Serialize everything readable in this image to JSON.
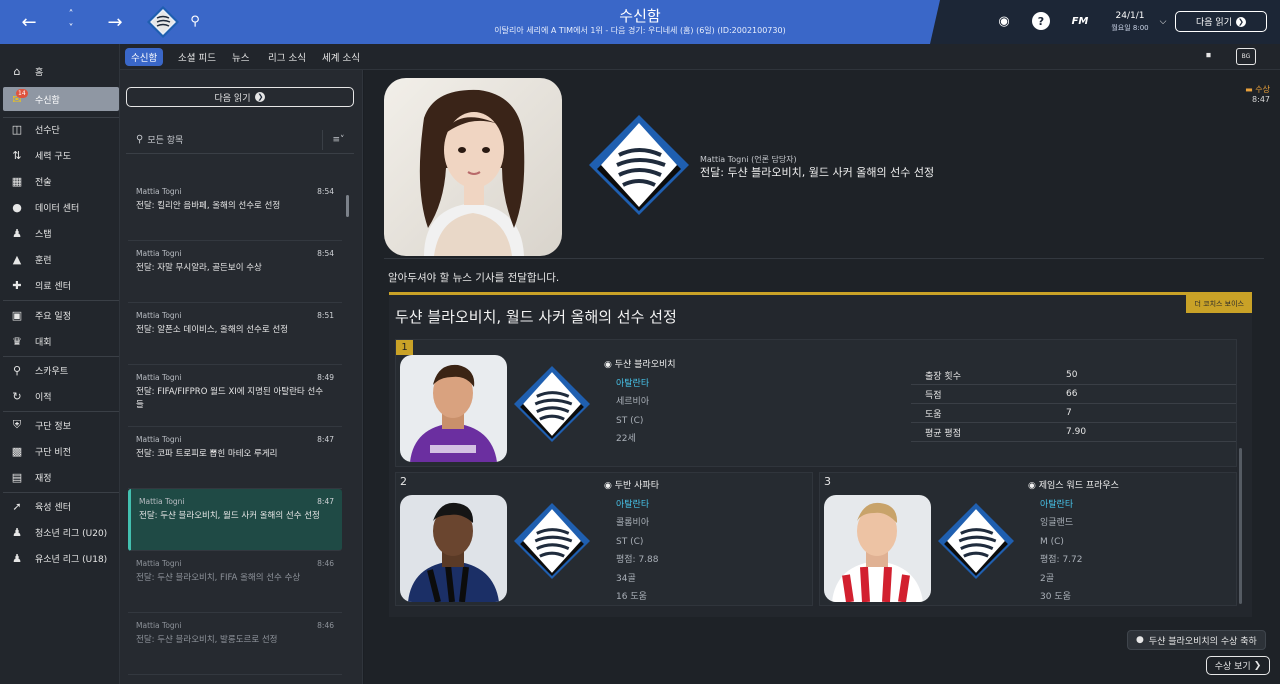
{
  "topbar": {
    "title": "수신함",
    "subtitle": "이탈리아 세리에 A TIM에서 1위 - 다음 경기: 우디네세 (홈) (6일) (ID:2002100730)",
    "date": "24/1/1",
    "day": "월요일 8:00",
    "next_label": "다음 읽기",
    "fm_label": "FM"
  },
  "sidebar": {
    "items": [
      {
        "label": "홈",
        "icon": "home-icon"
      },
      {
        "label": "수신함",
        "icon": "inbox-icon",
        "badge": "14"
      },
      {
        "label": "선수단",
        "icon": "shirt-icon"
      },
      {
        "label": "세력 구도",
        "icon": "dynamics-icon"
      },
      {
        "label": "전술",
        "icon": "tactics-icon"
      },
      {
        "label": "데이터 센터",
        "icon": "data-icon"
      },
      {
        "label": "스탭",
        "icon": "staff-icon"
      },
      {
        "label": "훈련",
        "icon": "training-icon"
      },
      {
        "label": "의료 센터",
        "icon": "medical-icon"
      },
      {
        "label": "주요 일정",
        "icon": "calendar-icon"
      },
      {
        "label": "대회",
        "icon": "trophy-icon"
      },
      {
        "label": "스카우트",
        "icon": "scout-icon"
      },
      {
        "label": "이적",
        "icon": "transfer-icon"
      },
      {
        "label": "구단 정보",
        "icon": "shield-icon"
      },
      {
        "label": "구단 비전",
        "icon": "vision-icon"
      },
      {
        "label": "재정",
        "icon": "finance-icon"
      },
      {
        "label": "육성 센터",
        "icon": "development-icon"
      },
      {
        "label": "청소년 리그 (U20)",
        "icon": "youth-icon"
      },
      {
        "label": "유소년 리그 (U18)",
        "icon": "youth-icon"
      }
    ]
  },
  "subtabs": [
    "수신함",
    "소셜 피드",
    "뉴스",
    "리그 소식",
    "세계 소식"
  ],
  "list": {
    "next_label": "다음 읽기",
    "search_placeholder": "모든 항목",
    "messages": [
      {
        "from": "Mattia Togni",
        "time": "8:54",
        "subject": "전달: 킬리안 음바페, 올해의 선수로 선정"
      },
      {
        "from": "Mattia Togni",
        "time": "8:54",
        "subject": "전달: 자말 무시알라, 골든보이 수상"
      },
      {
        "from": "Mattia Togni",
        "time": "8:51",
        "subject": "전달: 알폰소 데이비스, 올해의 선수로 선정"
      },
      {
        "from": "Mattia Togni",
        "time": "8:49",
        "subject": "전달: FIFA/FIFPRO 월드 XI에 지명된 아탈란타 선수들"
      },
      {
        "from": "Mattia Togni",
        "time": "8:47",
        "subject": "전달: 코파 트로피로 뽑힌 마테오 루게리"
      },
      {
        "from": "Mattia Togni",
        "time": "8:47",
        "subject": "전달: 두샨 블라오비치, 월드 사커 올해의 선수 선정"
      },
      {
        "from": "Mattia Togni",
        "time": "8:46",
        "subject": "전달: 두샨 블라오비치, FIFA 올해의 선수 수상"
      },
      {
        "from": "Mattia Togni",
        "time": "8:46",
        "subject": "전달: 두샨 블라오비치, 발롱도르로 선정"
      }
    ]
  },
  "detail": {
    "from": "Mattia Togni (언론 담당자)",
    "subject": "전달: 두샨 블라오비치, 월드 사커 올해의 선수 선정",
    "tag": "수상",
    "time": "8:47",
    "intro": "알아두셔야 할 뉴스 기사를 전달합니다.",
    "article_tag": "더 코치스 보이스",
    "article_title": "두샨 블라오비치, 월드 사커 올해의 선수 선정",
    "players": [
      {
        "rank": "1",
        "name": "두샨 블라오비치",
        "club": "아탈란타",
        "nation": "세르비아",
        "position": "ST (C)",
        "age": "22세"
      },
      {
        "rank": "2",
        "name": "두반 사파타",
        "club": "아탈란타",
        "nation": "콜롬비아",
        "position": "ST (C)",
        "rating": "평점: 7.88",
        "goals": "34골",
        "assists": "16 도움"
      },
      {
        "rank": "3",
        "name": "제임스 워드 프라우스",
        "club": "아탈란타",
        "nation": "잉글랜드",
        "position": "M (C)",
        "rating": "평점: 7.72",
        "goals": "2골",
        "assists": "30 도움"
      }
    ],
    "stats": [
      {
        "label": "출장 횟수",
        "value": "50"
      },
      {
        "label": "득점",
        "value": "66"
      },
      {
        "label": "도움",
        "value": "7"
      },
      {
        "label": "평균 평점",
        "value": "7.90"
      }
    ],
    "react_label": "두샨 블라오비치의 수상 축하",
    "award_label": "수상 보기"
  }
}
